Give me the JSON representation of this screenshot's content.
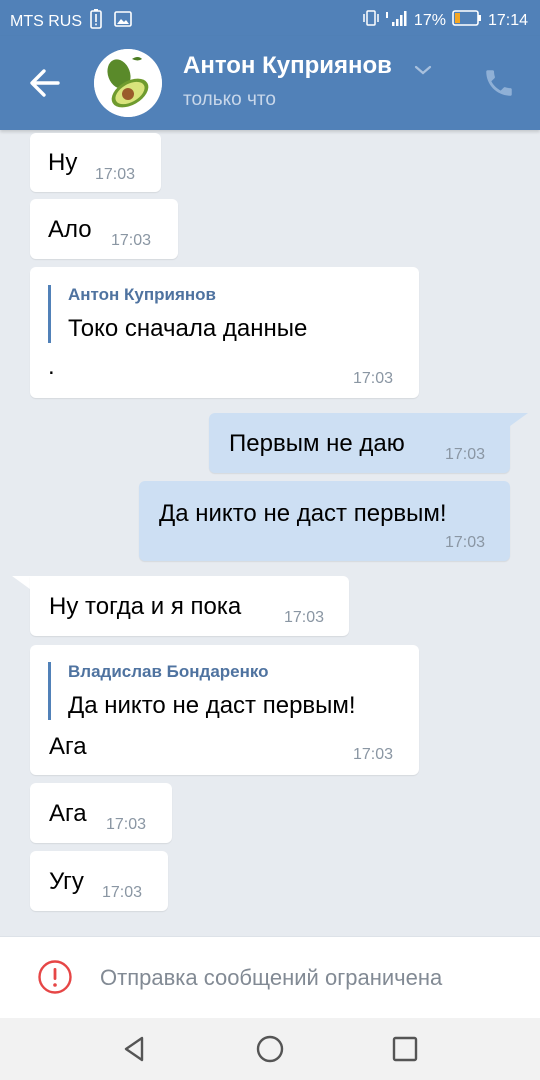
{
  "status_bar": {
    "carrier": "MTS RUS",
    "battery_percent": "17%",
    "time": "17:14"
  },
  "header": {
    "contact_name": "Антон Куприянов",
    "last_seen": "только что",
    "icons": [
      "back-arrow-icon",
      "avocado-avatar",
      "chevron-down-icon",
      "phone-icon"
    ]
  },
  "messages": [
    {
      "direction": "in",
      "text": "Ну",
      "time": "17:03"
    },
    {
      "direction": "in",
      "text": "Ало",
      "time": "17:03"
    },
    {
      "direction": "in",
      "quote_author": "Антон Куприянов",
      "quote_text": "Токо сначала данные",
      "text": ".",
      "time": "17:03"
    },
    {
      "direction": "out",
      "text": "Первым не даю",
      "time": "17:03"
    },
    {
      "direction": "out",
      "text": "Да никто не даст первым!",
      "time": "17:03"
    },
    {
      "direction": "in",
      "text": "Ну тогда и я пока",
      "time": "17:03"
    },
    {
      "direction": "in",
      "quote_author": "Владислав Бондаренко",
      "quote_text": "Да никто не даст первым!",
      "text": "Ага",
      "time": "17:03"
    },
    {
      "direction": "in",
      "text": "Ага",
      "time": "17:03"
    },
    {
      "direction": "in",
      "text": "Угу",
      "time": "17:03"
    }
  ],
  "restriction": {
    "text": "Отправка сообщений ограничена",
    "icon": "alert-circle-icon"
  },
  "colors": {
    "header": "#5181b8",
    "background": "#e7ebf0",
    "outgoing_bubble": "#cddff3",
    "incoming_bubble": "#ffffff",
    "alert": "#e64646"
  }
}
